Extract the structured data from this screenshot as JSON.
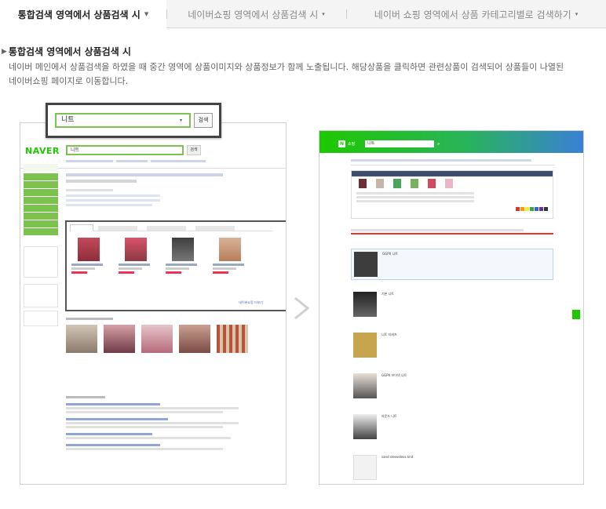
{
  "tabs": [
    {
      "label": "통합검색 영역에서 상품검색 시",
      "active": true
    },
    {
      "label": "네이버쇼핑 영역에서 상품검색 시",
      "active": false
    },
    {
      "label": "네이버 쇼핑 영역에서 상품 카테고리별로 검색하기",
      "active": false
    }
  ],
  "section": {
    "title": "통합검색 영역에서 상품검색 시",
    "description": "네이버 메인에서 상품검색을 하였을 때 중간 영역에 상품이미지와 상품정보가 함께 노출됩니다. 해당상품을 클릭하면 관련상품이 검색되어 상품들이 나열된 네이버쇼핑 페이지로 이동합니다."
  },
  "left_shot": {
    "logo": "NAVER",
    "query": "니트",
    "search_button": "검색",
    "shopping_label": "네이버쇼핑 더보기"
  },
  "zoom_box": {
    "query": "니트",
    "button": "검색"
  },
  "right_shot": {
    "brand": "쇼핑",
    "query": "니트",
    "products": [
      "GGPX 니트",
      "기본 니트",
      "니트 티셔츠",
      "GGPX 브이넥 니트",
      "라운드 니트",
      "sand sleeveless knit"
    ]
  },
  "colors": {
    "naver_green": "#1ec800",
    "accent_green": "#7cc24e",
    "arrow": "#cfcfcf"
  }
}
